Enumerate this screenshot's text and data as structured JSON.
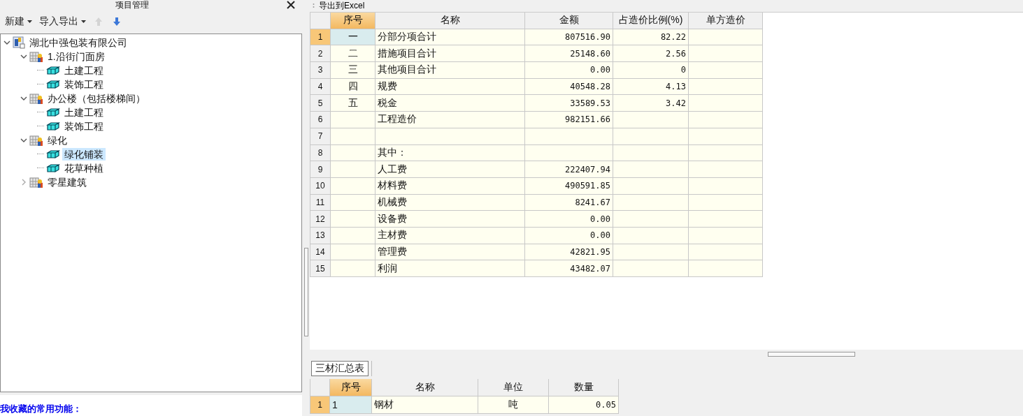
{
  "project_panel": {
    "title": "项目管理",
    "toolbar": {
      "menus": [
        {
          "label": "新建"
        },
        {
          "label": "导入导出"
        }
      ],
      "move_up": {
        "disabled": true
      },
      "move_down": {
        "disabled": false
      }
    },
    "tree": [
      {
        "label": "湖北中强包装有限公司",
        "kind": "company",
        "expanded": true,
        "selected": false,
        "children": [
          {
            "label": "1.沿街门面房",
            "kind": "building",
            "expanded": true,
            "selected": false,
            "children": [
              {
                "label": "土建工程",
                "kind": "unit",
                "selected": false
              },
              {
                "label": "装饰工程",
                "kind": "unit",
                "selected": false
              }
            ]
          },
          {
            "label": "办公楼（包括楼梯间）",
            "kind": "building",
            "expanded": true,
            "selected": false,
            "children": [
              {
                "label": "土建工程",
                "kind": "unit",
                "selected": false
              },
              {
                "label": "装饰工程",
                "kind": "unit",
                "selected": false
              }
            ]
          },
          {
            "label": "绿化",
            "kind": "building",
            "expanded": true,
            "selected": false,
            "children": [
              {
                "label": "绿化铺装",
                "kind": "unit",
                "selected": true
              },
              {
                "label": "花草种植",
                "kind": "unit",
                "selected": false
              }
            ]
          },
          {
            "label": "零星建筑",
            "kind": "building",
            "expanded": false,
            "selected": false
          }
        ]
      }
    ],
    "favorites_heading": "我收藏的常用功能："
  },
  "toolbar": {
    "export_button": "导出到Excel"
  },
  "summary_table": {
    "columns": [
      {
        "label": "序号",
        "selected": true
      },
      {
        "label": "名称",
        "selected": false
      },
      {
        "label": "金额",
        "selected": false
      },
      {
        "label": "占造价比例(%)",
        "selected": false
      },
      {
        "label": "单方造价",
        "selected": false
      }
    ],
    "rows": [
      {
        "number": "1",
        "selected": true,
        "cells": [
          "一",
          "分部分项合计",
          "807516.90",
          "82.22",
          ""
        ]
      },
      {
        "number": "2",
        "selected": false,
        "cells": [
          "二",
          "措施项目合计",
          "25148.60",
          "2.56",
          ""
        ]
      },
      {
        "number": "3",
        "selected": false,
        "cells": [
          "三",
          "其他项目合计",
          "0.00",
          "0",
          ""
        ]
      },
      {
        "number": "4",
        "selected": false,
        "cells": [
          "四",
          "规费",
          "40548.28",
          "4.13",
          ""
        ]
      },
      {
        "number": "5",
        "selected": false,
        "cells": [
          "五",
          "税金",
          "33589.53",
          "3.42",
          ""
        ]
      },
      {
        "number": "6",
        "selected": false,
        "cells": [
          "",
          "工程造价",
          "982151.66",
          "",
          ""
        ]
      },
      {
        "number": "7",
        "selected": false,
        "cells": [
          "",
          "",
          "",
          "",
          ""
        ]
      },
      {
        "number": "8",
        "selected": false,
        "cells": [
          "",
          "其中：",
          "",
          "",
          ""
        ]
      },
      {
        "number": "9",
        "selected": false,
        "cells": [
          "",
          "人工费",
          "222407.94",
          "",
          ""
        ]
      },
      {
        "number": "10",
        "selected": false,
        "cells": [
          "",
          "材料费",
          "490591.85",
          "",
          ""
        ]
      },
      {
        "number": "11",
        "selected": false,
        "cells": [
          "",
          "机械费",
          "8241.67",
          "",
          ""
        ]
      },
      {
        "number": "12",
        "selected": false,
        "cells": [
          "",
          "设备费",
          "0.00",
          "",
          ""
        ]
      },
      {
        "number": "13",
        "selected": false,
        "cells": [
          "",
          "主材费",
          "0.00",
          "",
          ""
        ]
      },
      {
        "number": "14",
        "selected": false,
        "cells": [
          "",
          "管理费",
          "42821.95",
          "",
          ""
        ]
      },
      {
        "number": "15",
        "selected": false,
        "cells": [
          "",
          "利润",
          "43482.07",
          "",
          ""
        ]
      }
    ]
  },
  "bottom_tabs": [
    {
      "label": "三材汇总表",
      "selected": true
    }
  ],
  "materials_table": {
    "columns": [
      {
        "label": "序号",
        "selected": true
      },
      {
        "label": "名称",
        "selected": false
      },
      {
        "label": "单位",
        "selected": false
      },
      {
        "label": "数量",
        "selected": false
      }
    ],
    "rows": [
      {
        "number": "1",
        "selected": true,
        "cells": [
          "1",
          "钢材",
          "吨",
          "0.05"
        ]
      }
    ]
  }
}
